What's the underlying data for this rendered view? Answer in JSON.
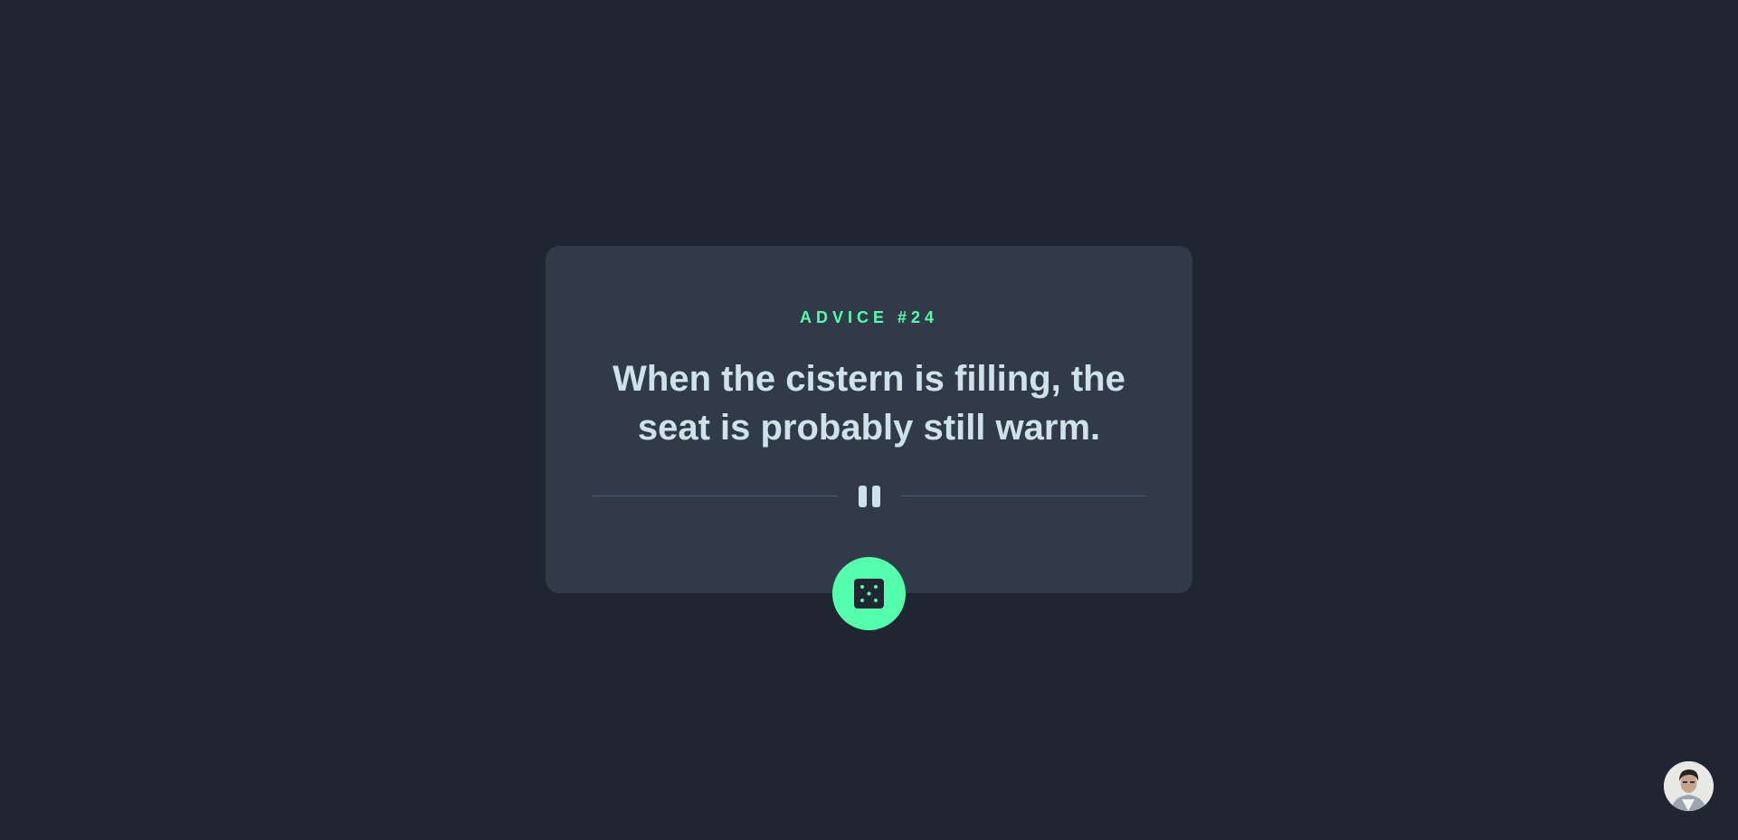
{
  "advice": {
    "label": "Advice #24",
    "quote": "When the cistern is filling, the seat is probably still warm."
  },
  "icons": {
    "divider": "pause-icon",
    "generate": "dice-icon",
    "avatar": "user-avatar"
  },
  "colors": {
    "background": "#1f2632",
    "card": "#313a48",
    "accent": "#53ffaa",
    "text": "#cee3e9",
    "divider": "#4f5d74"
  }
}
